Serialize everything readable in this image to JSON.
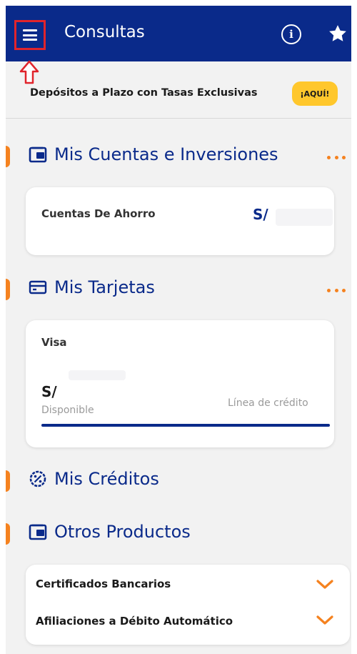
{
  "header": {
    "title": "Consultas"
  },
  "promo": {
    "text": "Depósitos a Plazo con Tasas Exclusivas",
    "button_label": "¡AQUÍ!"
  },
  "accounts": {
    "title": "Mis Cuentas e Inversiones",
    "item_label": "Cuentas De Ahorro",
    "currency": "S/"
  },
  "cards": {
    "title": "Mis Tarjetas",
    "card_name": "Visa",
    "currency": "S/",
    "available_label": "Disponible",
    "credit_line_label": "Línea de crédito",
    "usage_fraction": 1.0
  },
  "credits": {
    "title": "Mis Créditos"
  },
  "other": {
    "title": "Otros Productos",
    "items": [
      {
        "label": "Certificados Bancarios"
      },
      {
        "label": "Afiliaciones a Débito Automático"
      }
    ]
  },
  "colors": {
    "primary": "#0a2a8a",
    "accent": "#f5821f",
    "promo_button": "#ffc72c",
    "annotation": "#e0242c"
  }
}
